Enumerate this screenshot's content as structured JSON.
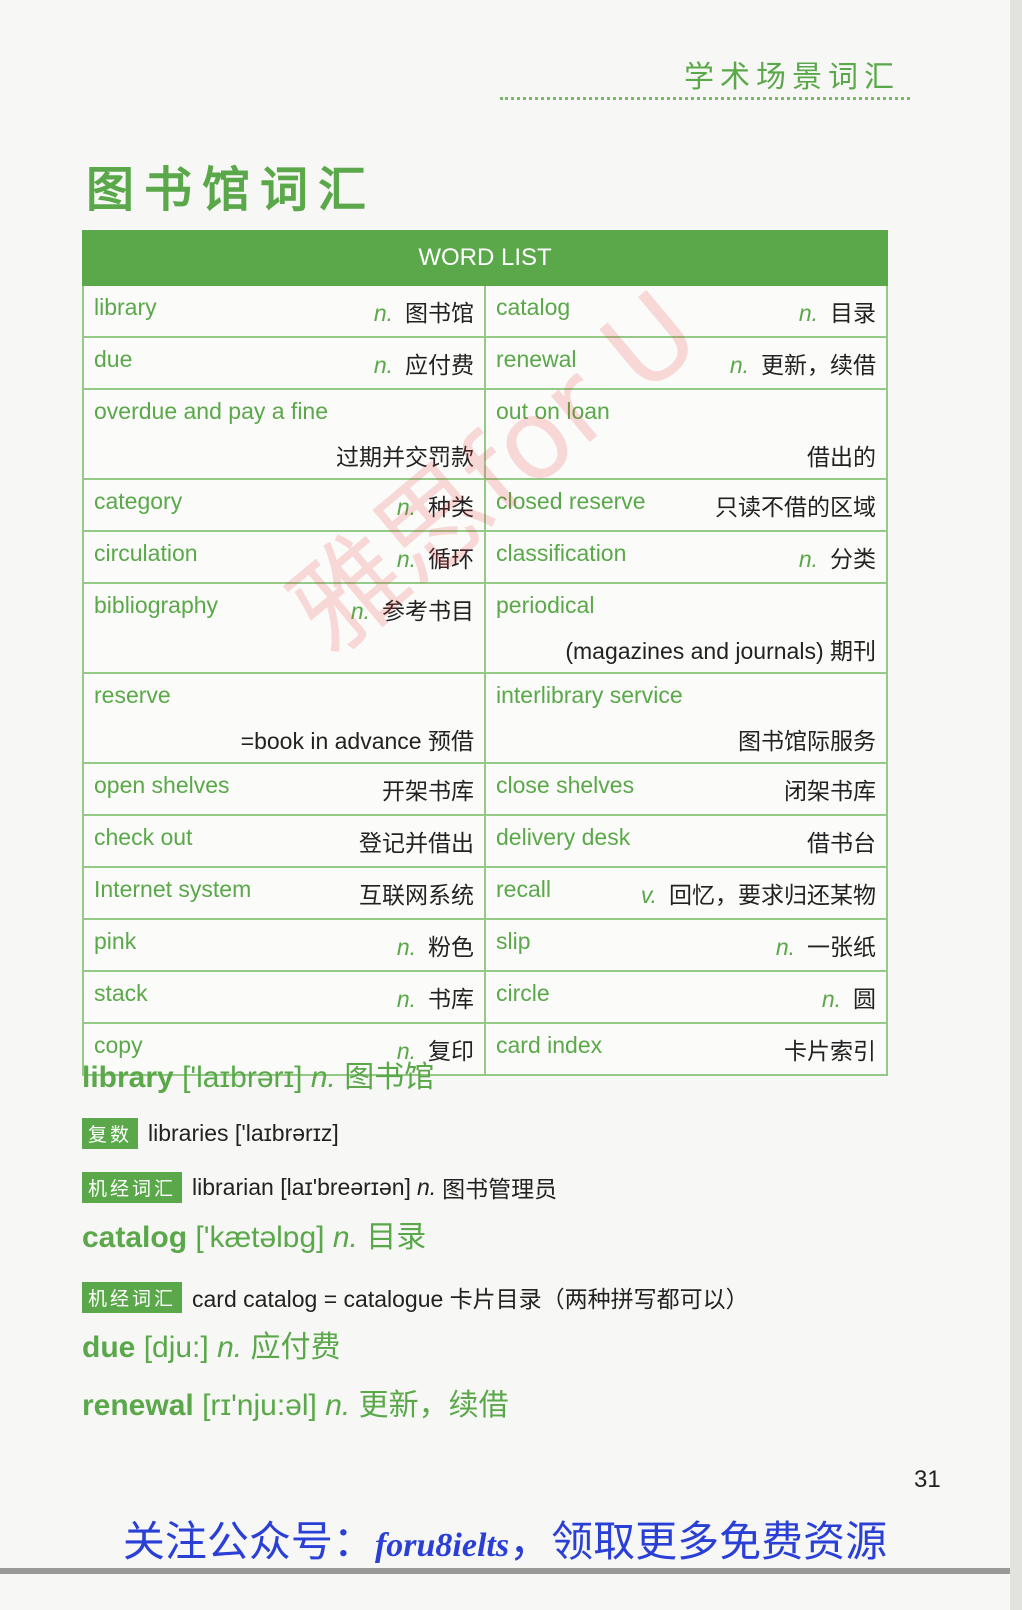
{
  "header": {
    "section_title": "学术场景词汇"
  },
  "page_heading": "图书馆词汇",
  "word_list": {
    "title": "WORD LIST",
    "rows": [
      {
        "layout": "single",
        "left": {
          "en": "library",
          "pos": "n.",
          "zh": "图书馆"
        },
        "right": {
          "en": "catalog",
          "pos": "n.",
          "zh": "目录"
        }
      },
      {
        "layout": "single",
        "left": {
          "en": "due",
          "pos": "n.",
          "zh": "应付费"
        },
        "right": {
          "en": "renewal",
          "pos": "n.",
          "zh": "更新，续借"
        }
      },
      {
        "layout": "double",
        "left": {
          "en": "overdue and pay a fine",
          "pos": "",
          "zh": "过期并交罚款"
        },
        "right": {
          "en": "out on loan",
          "pos": "",
          "zh": "借出的"
        }
      },
      {
        "layout": "single",
        "left": {
          "en": "category",
          "pos": "n.",
          "zh": "种类"
        },
        "right": {
          "en": "closed reserve",
          "pos": "",
          "zh": "只读不借的区域"
        }
      },
      {
        "layout": "single",
        "left": {
          "en": "circulation",
          "pos": "n.",
          "zh": "循环"
        },
        "right": {
          "en": "classification",
          "pos": "n.",
          "zh": "分类"
        }
      },
      {
        "layout": "double",
        "left": {
          "en": "bibliography",
          "pos": "n.",
          "zh": "参考书目"
        },
        "right": {
          "en": "periodical",
          "pos": "",
          "zh": "(magazines and journals) 期刊"
        }
      },
      {
        "layout": "double",
        "left": {
          "en": "reserve",
          "pos": "",
          "zh": "=book in advance 预借"
        },
        "right": {
          "en": "interlibrary service",
          "pos": "",
          "zh": "图书馆际服务"
        }
      },
      {
        "layout": "single",
        "left": {
          "en": "open shelves",
          "pos": "",
          "zh": "开架书库"
        },
        "right": {
          "en": "close shelves",
          "pos": "",
          "zh": "闭架书库"
        }
      },
      {
        "layout": "single",
        "left": {
          "en": "check out",
          "pos": "",
          "zh": "登记并借出"
        },
        "right": {
          "en": "delivery desk",
          "pos": "",
          "zh": "借书台"
        }
      },
      {
        "layout": "single",
        "left": {
          "en": "Internet system",
          "pos": "",
          "zh": "互联网系统"
        },
        "right": {
          "en": "recall",
          "pos": "v.",
          "zh": "回忆，要求归还某物"
        }
      },
      {
        "layout": "single",
        "left": {
          "en": "pink",
          "pos": "n.",
          "zh": "粉色"
        },
        "right": {
          "en": "slip",
          "pos": "n.",
          "zh": "一张纸"
        }
      },
      {
        "layout": "single",
        "left": {
          "en": "stack",
          "pos": "n.",
          "zh": "书库"
        },
        "right": {
          "en": "circle",
          "pos": "n.",
          "zh": "圆"
        }
      },
      {
        "layout": "single",
        "left": {
          "en": "copy",
          "pos": "n.",
          "zh": "复印"
        },
        "right": {
          "en": "card index",
          "pos": "",
          "zh": "卡片索引"
        }
      }
    ]
  },
  "entries": {
    "library": {
      "word": "library",
      "phonetic": "['laɪbrərɪ]",
      "pos": "n.",
      "def": "图书馆"
    },
    "library_plural": {
      "tag": "复数",
      "text": "libraries ['laɪbrərɪz]"
    },
    "library_related": {
      "tag": "机经词汇",
      "text": "librarian [laɪ'breərɪən]",
      "pos": "n.",
      "def": "图书管理员"
    },
    "catalog": {
      "word": "catalog",
      "phonetic": "['kætəlɒg]",
      "pos": "n.",
      "def": "目录"
    },
    "catalog_related": {
      "tag": "机经词汇",
      "text": "card catalog = catalogue 卡片目录（两种拼写都可以）"
    },
    "due": {
      "word": "due",
      "phonetic": "[dju:]",
      "pos": "n.",
      "def": "应付费"
    },
    "renewal": {
      "word": "renewal",
      "phonetic": "[rɪ'nju:əl]",
      "pos": "n.",
      "def": "更新，续借"
    }
  },
  "page_number": "31",
  "footer": {
    "prefix": "关注公众号：",
    "handle": "foru8ielts",
    "suffix": "，领取更多免费资源"
  },
  "watermark": "雅思for U",
  "colors": {
    "accent_green": "#5aa84a",
    "border_green": "#94c988",
    "footer_blue": "#2a3fd6"
  }
}
